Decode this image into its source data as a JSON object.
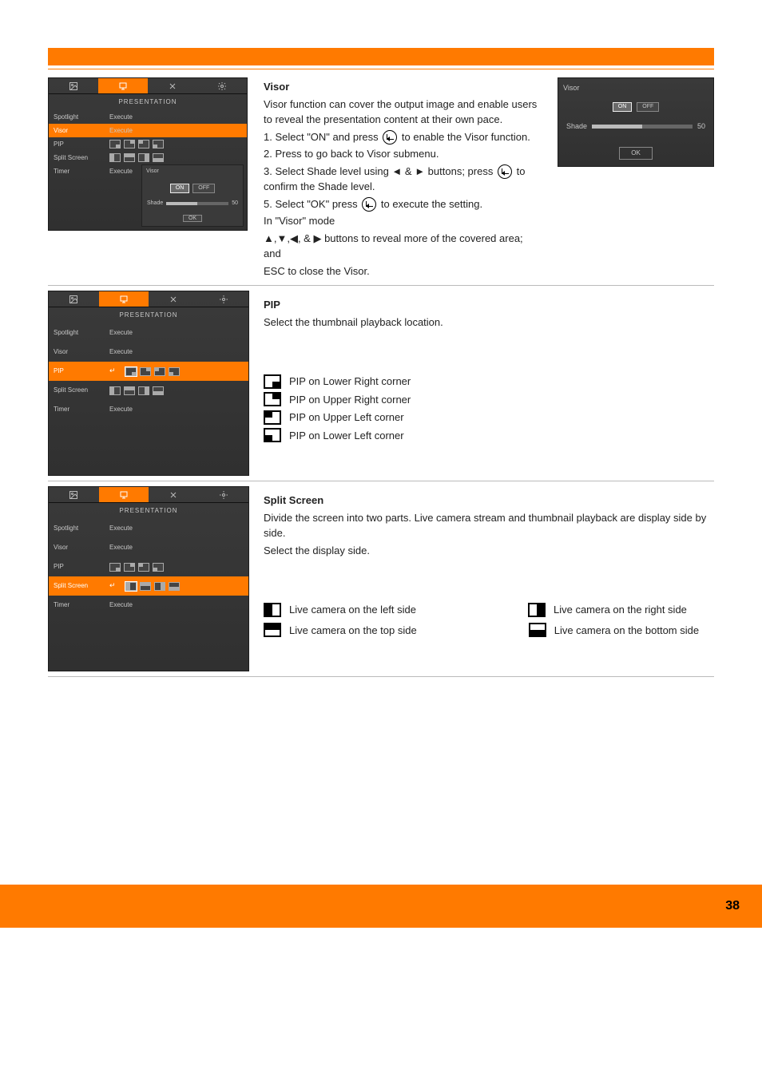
{
  "menu_header": "PRESENTATION",
  "menu_items": {
    "spotlight": "Spotlight",
    "visor": "Visor",
    "pip": "PIP",
    "split": "Split Screen",
    "timer": "Timer",
    "execute": "Execute"
  },
  "visor_popup": {
    "title": "Visor",
    "on": "ON",
    "off": "OFF",
    "shade": "Shade",
    "shade_val": "50",
    "ok": "OK"
  },
  "visor_section": {
    "title": "Visor",
    "p1": "Visor function can cover the output image and enable users to reveal the presentation content at their own pace.",
    "p2_a": "1. Select \"ON\" and press",
    "p2_b": " to enable the Visor function.",
    "p3_a": "2. Press ",
    "p3_b": " to go back to Visor submenu.",
    "p4_a": "3. Select Shade level using ◄ & ► buttons; press ",
    "p4_b": " to confirm the Shade level.",
    "p5_a": "5. Select \"OK\" press ",
    "p5_b": " to execute the setting.",
    "p6": "In \"Visor\" mode",
    "p7": "▲,▼,◀, & ▶ buttons to reveal more of the covered area; and",
    "p8": "ESC to close the Visor."
  },
  "pip_section": {
    "title": "PIP",
    "p1": "Select the thumbnail playback location.",
    "lower_right": "PIP on Lower Right corner",
    "upper_right": "PIP on Upper Right corner",
    "upper_left": "PIP on Upper Left corner",
    "lower_left": "PIP on Lower Left corner"
  },
  "split_section": {
    "title": "Split Screen",
    "p1": "Divide the screen into two parts. Live camera stream and thumbnail playback are display side by side.",
    "p2": "Select the display side.",
    "left": "Live camera on the left side",
    "top": "Live camera on the top side",
    "right": "Live camera on the right side",
    "bottom": "Live camera on the bottom side"
  },
  "footer_page": "38"
}
